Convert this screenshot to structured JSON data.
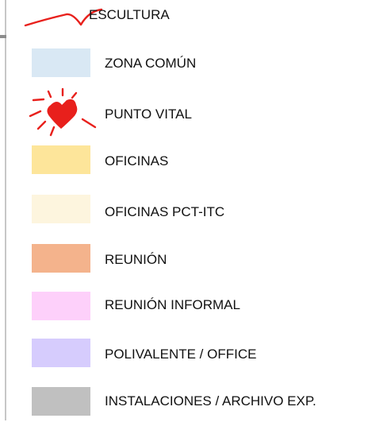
{
  "legend": {
    "items": [
      {
        "key": "escultura",
        "label": "ESCULTURA",
        "kind": "line",
        "color": "#e8201c"
      },
      {
        "key": "zona-comun",
        "label": "ZONA COMÚN",
        "kind": "swatch",
        "color": "#d9e8f4"
      },
      {
        "key": "punto-vital",
        "label": "PUNTO VITAL",
        "kind": "heart",
        "color": "#e8201c"
      },
      {
        "key": "oficinas",
        "label": "OFICINAS",
        "kind": "swatch",
        "color": "#fde59a"
      },
      {
        "key": "oficinas-pct-itc",
        "label": "OFICINAS PCT-ITC",
        "kind": "swatch",
        "color": "#fdf5de"
      },
      {
        "key": "reunion",
        "label": "REUNIÓN",
        "kind": "swatch",
        "color": "#f4b38c"
      },
      {
        "key": "reunion-informal",
        "label": "REUNIÓN INFORMAL",
        "kind": "swatch",
        "color": "#fdd0fa"
      },
      {
        "key": "polivalente-office",
        "label": "POLIVALENTE / OFFICE",
        "kind": "swatch",
        "color": "#d6ccfd"
      },
      {
        "key": "instalaciones-archivo",
        "label": "INSTALACIONES / ARCHIVO EXP.",
        "kind": "swatch",
        "color": "#c0c0c0"
      }
    ]
  }
}
